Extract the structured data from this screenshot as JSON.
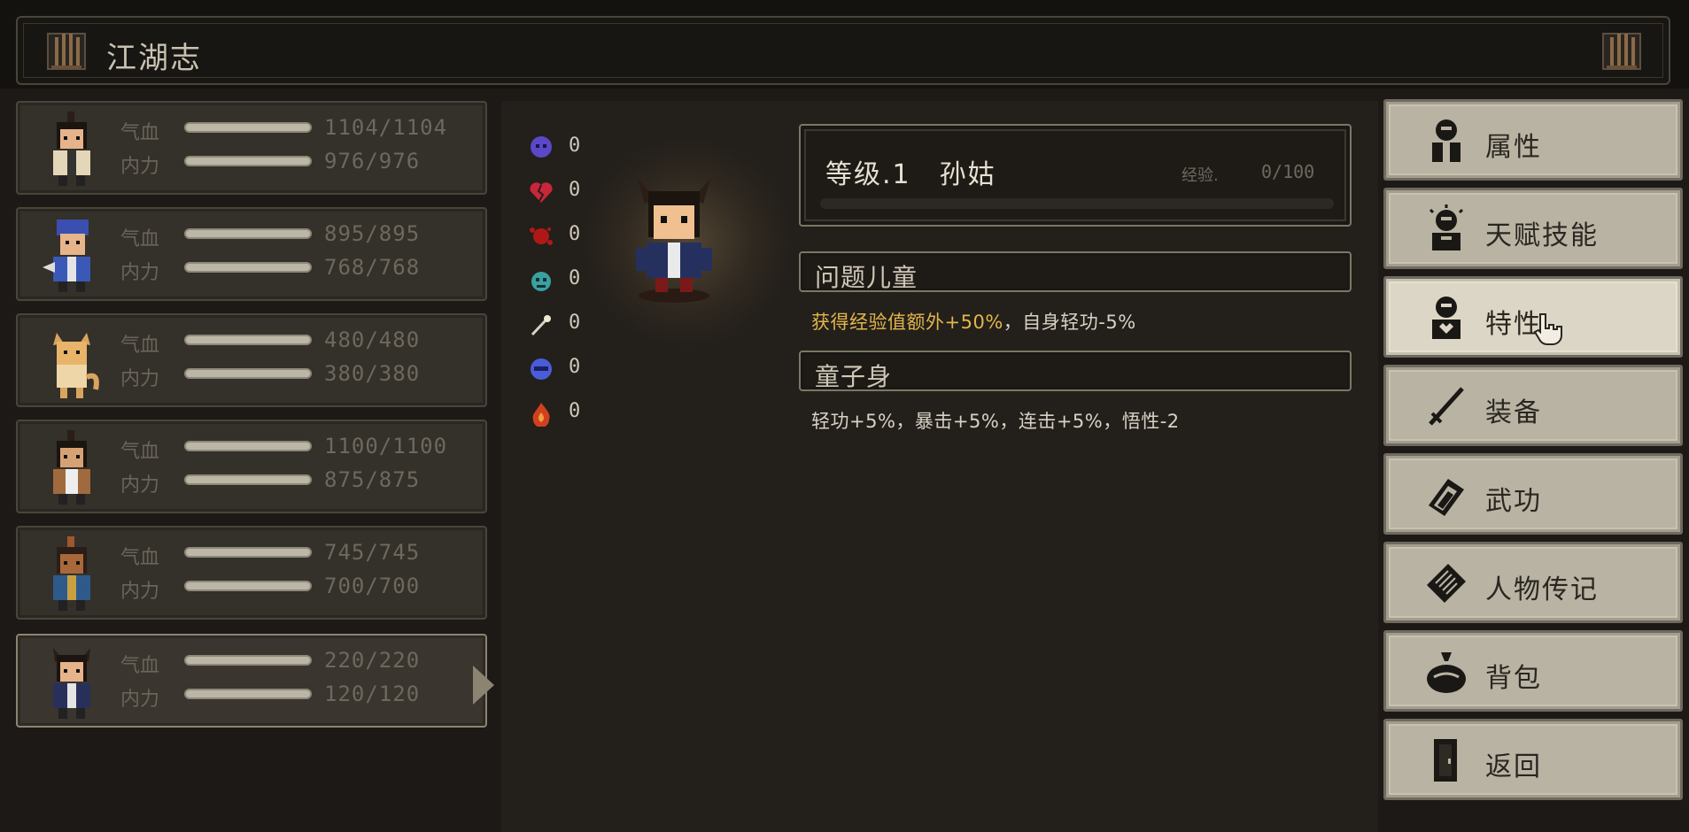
{
  "header": {
    "title": "江湖志"
  },
  "party": [
    {
      "hp_label": "气血",
      "mp_label": "内力",
      "hp": "1104/1104",
      "mp": "976/976"
    },
    {
      "hp_label": "气血",
      "mp_label": "内力",
      "hp": "895/895",
      "mp": "768/768"
    },
    {
      "hp_label": "气血",
      "mp_label": "内力",
      "hp": "480/480",
      "mp": "380/380"
    },
    {
      "hp_label": "气血",
      "mp_label": "内力",
      "hp": "1100/1100",
      "mp": "875/875"
    },
    {
      "hp_label": "气血",
      "mp_label": "内力",
      "hp": "745/745",
      "mp": "700/700"
    },
    {
      "hp_label": "气血",
      "mp_label": "内力",
      "hp": "220/220",
      "mp": "120/120"
    }
  ],
  "resources": [
    {
      "icon": "skull-icon",
      "value": "0"
    },
    {
      "icon": "broken-heart-icon",
      "value": "0"
    },
    {
      "icon": "blood-splat-icon",
      "value": "0"
    },
    {
      "icon": "demon-face-icon",
      "value": "0"
    },
    {
      "icon": "wand-icon",
      "value": "0"
    },
    {
      "icon": "mask-icon",
      "value": "0"
    },
    {
      "icon": "flame-icon",
      "value": "0"
    }
  ],
  "character": {
    "level_name": "等级.1　孙姑",
    "exp_label": "经验.",
    "exp_value": "0/100",
    "exp_fraction": 0
  },
  "traits": [
    {
      "name": "问题儿童",
      "desc_gold": "获得经验值额外+50%",
      "desc_rest": "，自身轻功-5%"
    },
    {
      "name": "童子身",
      "desc_gold": "",
      "desc_rest": "轻功+5%，暴击+5%，连击+5%，悟性-2"
    }
  ],
  "menu": [
    {
      "label": "属性",
      "icon": "person-icon"
    },
    {
      "label": "天赋技能",
      "icon": "talent-icon"
    },
    {
      "label": "特性",
      "icon": "trait-icon"
    },
    {
      "label": "装备",
      "icon": "sword-icon"
    },
    {
      "label": "武功",
      "icon": "book-icon"
    },
    {
      "label": "人物传记",
      "icon": "scroll-icon"
    },
    {
      "label": "背包",
      "icon": "bag-icon"
    },
    {
      "label": "返回",
      "icon": "door-icon"
    }
  ],
  "colors": {
    "accent_gold": "#e2b64a",
    "menu_bg": "#b9b3a3",
    "panel_bg": "#231f1b"
  }
}
